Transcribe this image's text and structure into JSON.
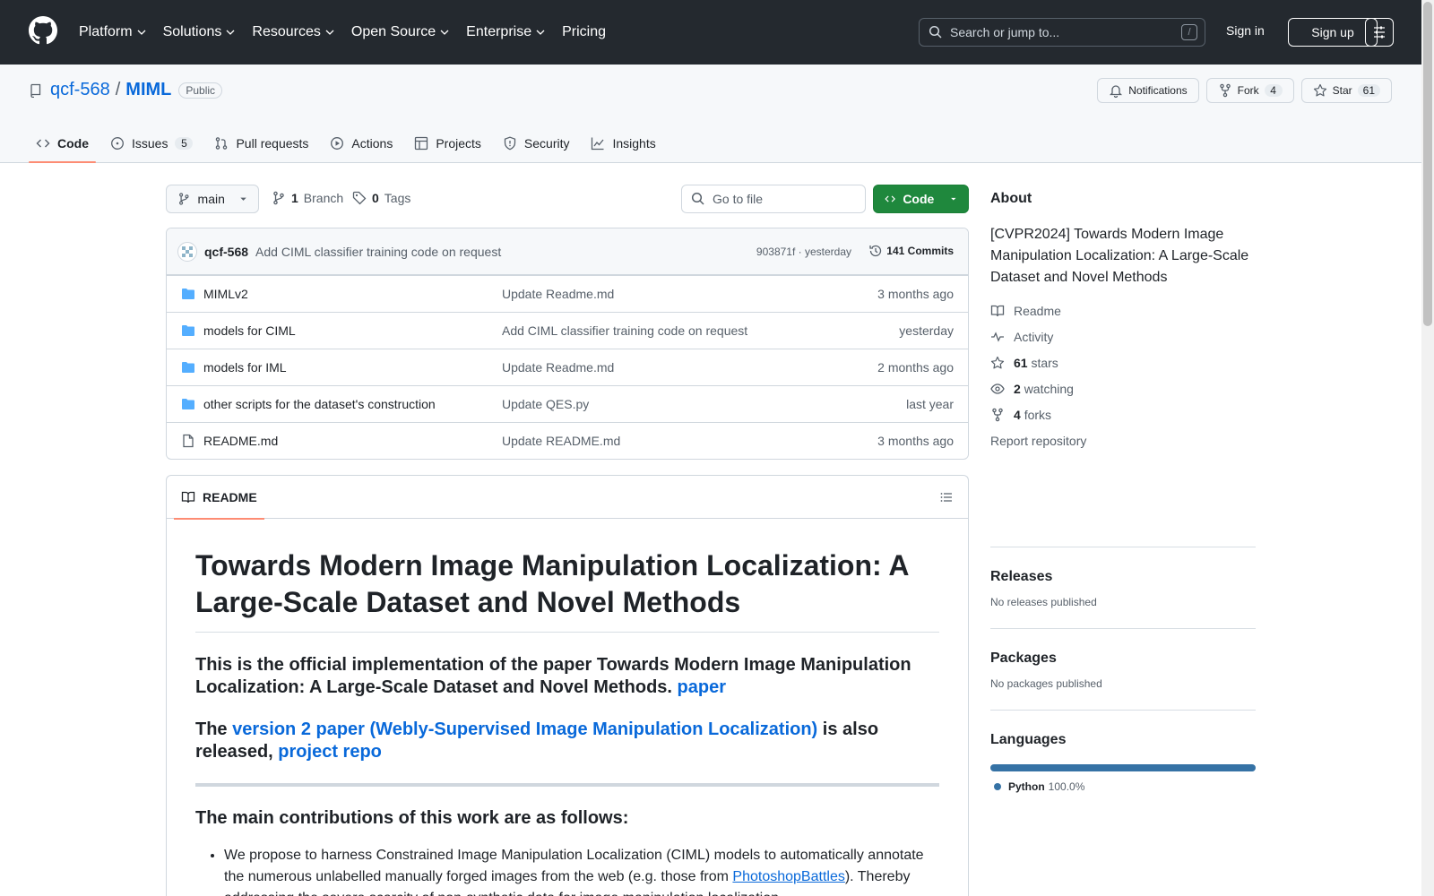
{
  "header": {
    "nav": [
      "Platform",
      "Solutions",
      "Resources",
      "Open Source",
      "Enterprise",
      "Pricing"
    ],
    "search_placeholder": "Search or jump to...",
    "search_shortcut": "/",
    "sign_in": "Sign in",
    "sign_up": "Sign up"
  },
  "repo": {
    "owner": "qcf-568",
    "separator": "/",
    "name": "MIML",
    "visibility": "Public",
    "actions": {
      "notifications": "Notifications",
      "fork": "Fork",
      "fork_count": "4",
      "star": "Star",
      "star_count": "61"
    },
    "tabs": [
      {
        "label": "Code",
        "icon": "code-icon",
        "active": true
      },
      {
        "label": "Issues",
        "icon": "issue-icon",
        "count": "5"
      },
      {
        "label": "Pull requests",
        "icon": "pull-request-icon"
      },
      {
        "label": "Actions",
        "icon": "play-icon"
      },
      {
        "label": "Projects",
        "icon": "table-icon"
      },
      {
        "label": "Security",
        "icon": "shield-icon"
      },
      {
        "label": "Insights",
        "icon": "graph-icon"
      }
    ]
  },
  "toolbar": {
    "branch": "main",
    "branch_count": "1",
    "branch_label": "Branch",
    "tag_count": "0",
    "tag_label": "Tags",
    "goto_placeholder": "Go to file",
    "code_button": "Code"
  },
  "latest_commit": {
    "author": "qcf-568",
    "message": "Add CIML classifier training code on request",
    "meta": "903871f · yesterday",
    "commits_label": "141 Commits"
  },
  "files": [
    {
      "name": "MIMLv2",
      "type": "folder",
      "message": "Update Readme.md",
      "time": "3 months ago"
    },
    {
      "name": "models for CIML",
      "type": "folder",
      "message": "Add CIML classifier training code on request",
      "time": "yesterday"
    },
    {
      "name": "models for IML",
      "type": "folder",
      "message": "Update Readme.md",
      "time": "2 months ago"
    },
    {
      "name": "other scripts for the dataset's construction",
      "type": "folder",
      "message": "Update QES.py",
      "time": "last year"
    },
    {
      "name": "README.md",
      "type": "file",
      "message": "Update README.md",
      "time": "3 months ago"
    }
  ],
  "readme": {
    "tab": "README",
    "title": "Towards Modern Image Manipulation Localization: A Large-Scale Dataset and Novel Methods",
    "intro_text": "This is the official implementation of the paper Towards Modern Image Manipulation Localization: A Large-Scale Dataset and Novel Methods.",
    "intro_link": "paper",
    "v2_prefix": "The",
    "v2_link": "version 2 paper (Webly-Supervised Image Manipulation Localization)",
    "v2_mid": "is also released,",
    "v2_repo_link": "project repo",
    "contrib_heading": "The main contributions of this work are as follows:",
    "bullet1_pre": "We propose to harness Constrained Image Manipulation Localization (CIML) models to automatically annotate the numerous unlabelled manually forged images from the web (e.g. those from",
    "bullet1_link": "PhotoshopBattles",
    "bullet1_post": "). Thereby addressing the severe scarcity of non-synthetic data for image manipulation localization."
  },
  "about": {
    "title": "About",
    "description": "[CVPR2024] Towards Modern Image Manipulation Localization: A Large-Scale Dataset and Novel Methods",
    "links": {
      "readme": "Readme",
      "activity": "Activity",
      "stars_count": "61",
      "stars_label": "stars",
      "watching_count": "2",
      "watching_label": "watching",
      "forks_count": "4",
      "forks_label": "forks"
    },
    "report": "Report repository"
  },
  "releases": {
    "title": "Releases",
    "note": "No releases published"
  },
  "packages": {
    "title": "Packages",
    "note": "No packages published"
  },
  "languages": {
    "title": "Languages",
    "items": [
      {
        "name": "Python",
        "percent": "100.0%",
        "fraction": 1.0,
        "color": "#3572A5"
      }
    ]
  },
  "colors": {
    "header_bg": "#24292f",
    "code_button": "#1f883d",
    "link": "#0969da",
    "tab_underline": "#fd8c73"
  }
}
